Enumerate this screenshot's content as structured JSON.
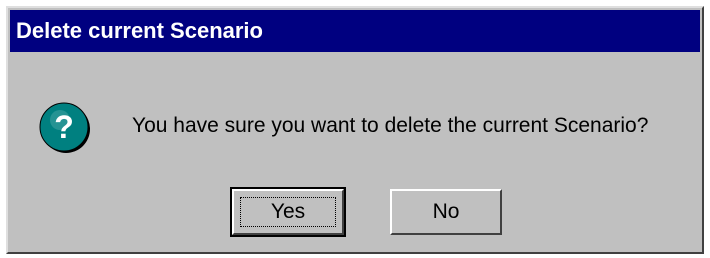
{
  "dialog": {
    "title": "Delete current Scenario",
    "message": "You have sure you want to delete the current Scenario?",
    "icon": "question-icon",
    "buttons": {
      "yes_label": "Yes",
      "no_label": "No"
    }
  },
  "colors": {
    "title_bar": "#000080",
    "title_text": "#ffffff",
    "face": "#c0c0c0",
    "icon_fill": "#008080"
  }
}
